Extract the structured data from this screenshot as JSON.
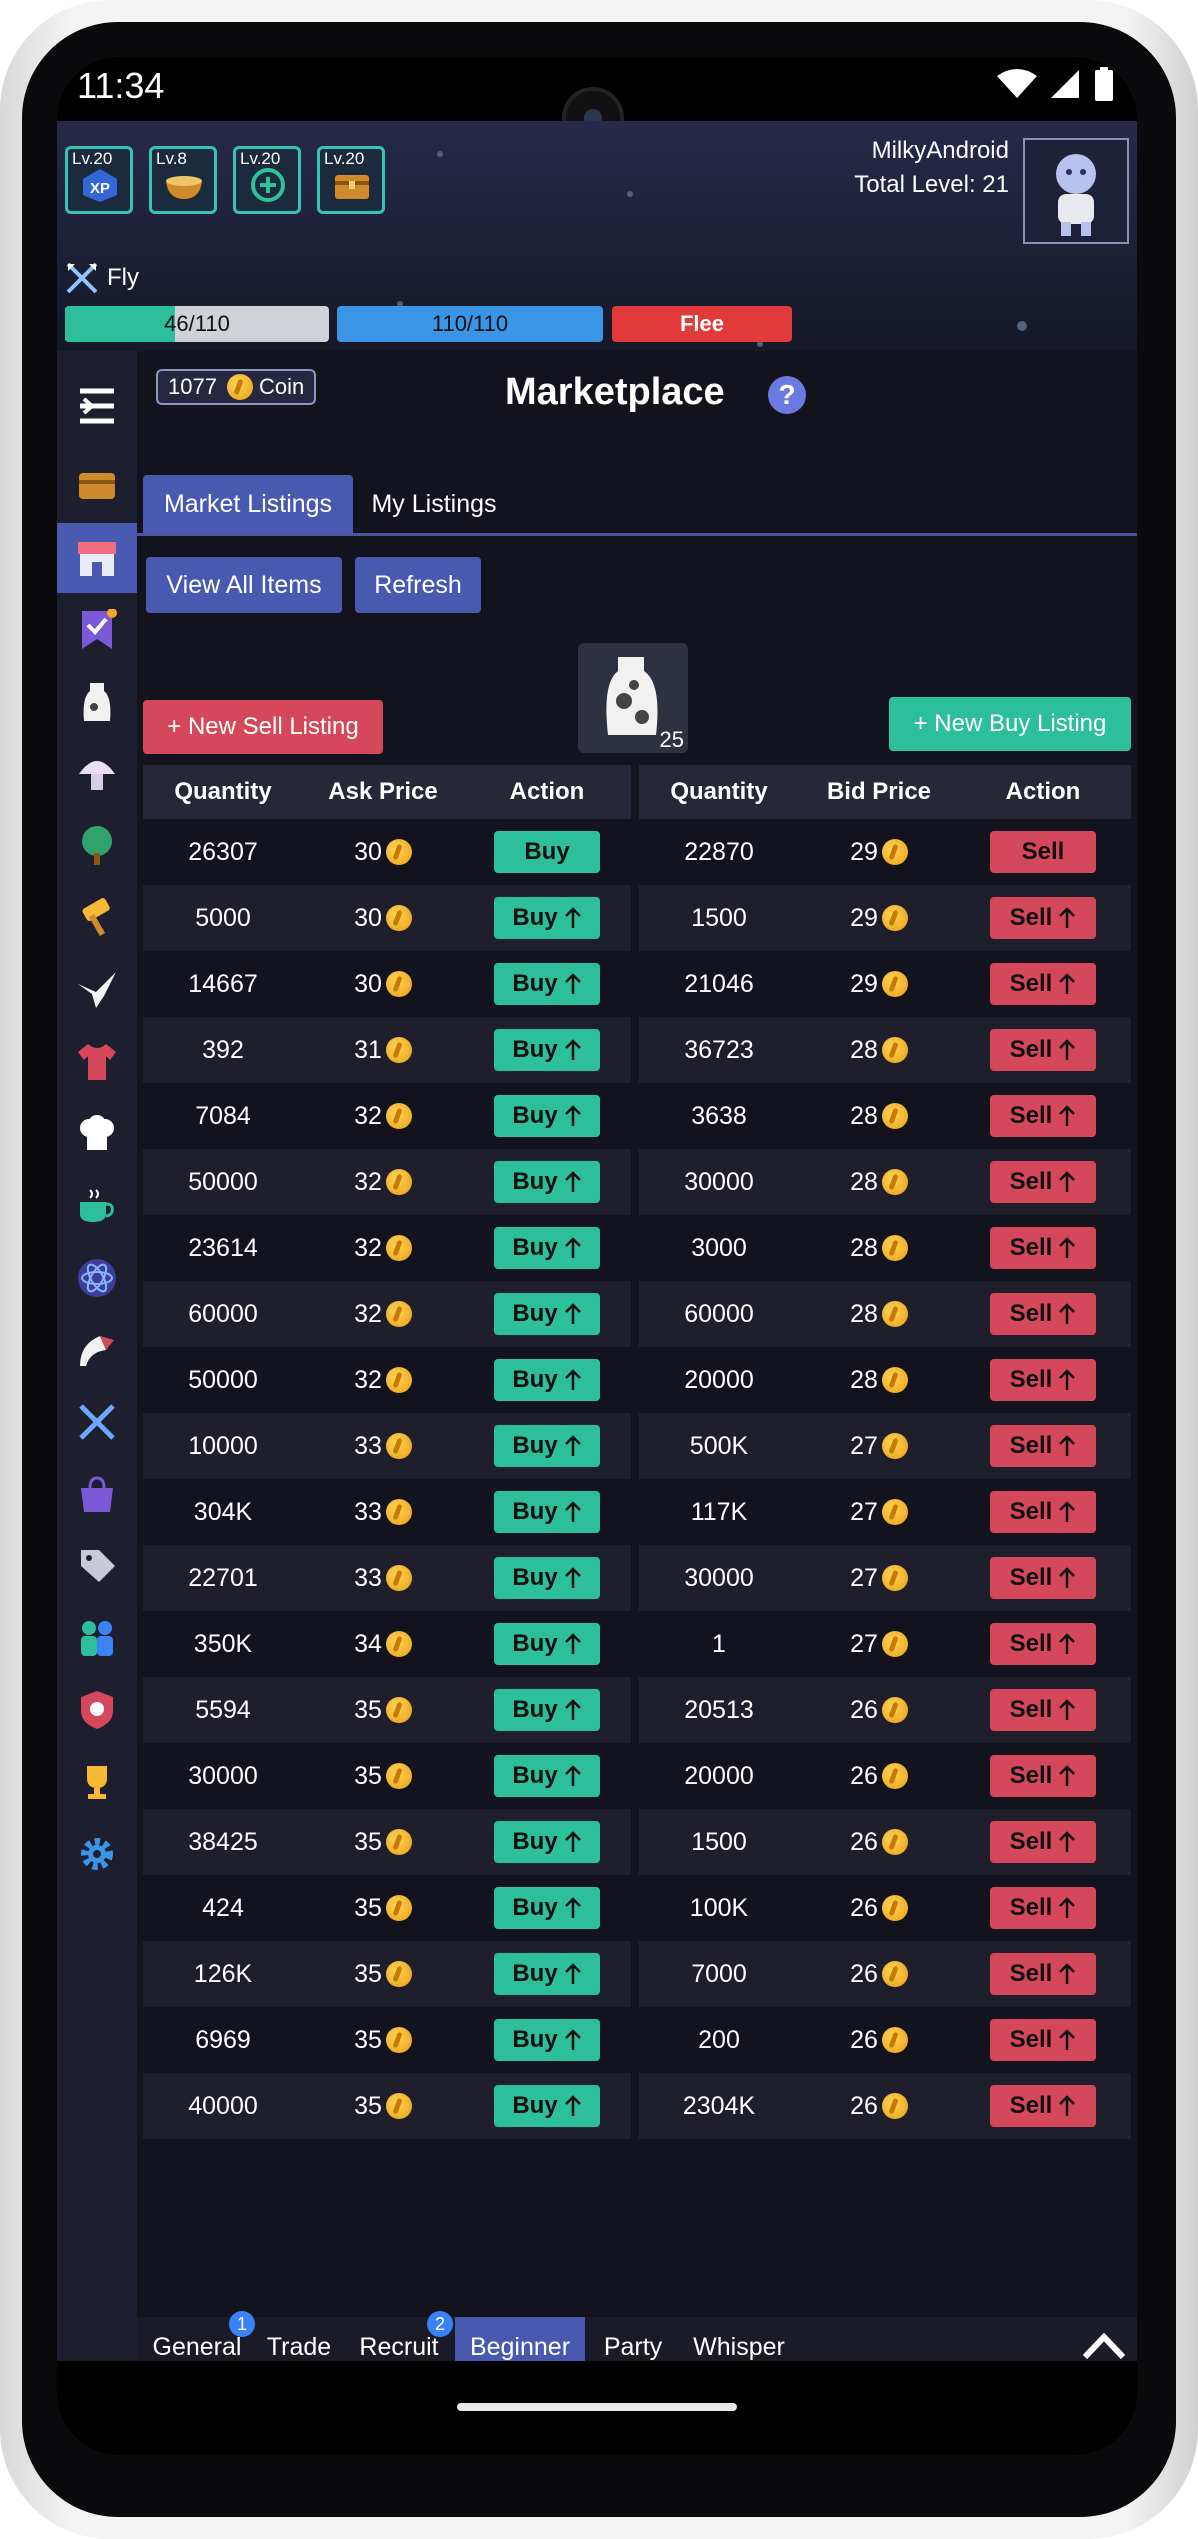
{
  "status_bar": {
    "time": "11:34"
  },
  "player": {
    "username": "MilkyAndroid",
    "total_level": "Total Level: 21",
    "skills": [
      {
        "level": "Lv.20",
        "icon": "xp-icon",
        "badge": "XP"
      },
      {
        "level": "Lv.8",
        "icon": "bowl-icon"
      },
      {
        "level": "Lv.20",
        "icon": "circle-plus-icon"
      },
      {
        "level": "Lv.20",
        "icon": "treasure-chest-icon"
      }
    ],
    "action": "Fly",
    "hp": "46/110",
    "hp_fraction": 0.418,
    "mp": "110/110",
    "mp_fraction": 1.0,
    "flee_label": "Flee"
  },
  "sidebar": {
    "items": [
      "menu-icon",
      "inventory-chest-icon",
      "marketplace-icon",
      "tasks-icon",
      "milk-icon",
      "mushroom-icon",
      "tree-icon",
      "hammer-icon",
      "origami-crane-icon",
      "shirt-icon",
      "chef-hat-icon",
      "tea-cup-icon",
      "atom-icon",
      "megaphone-icon",
      "swords-icon",
      "shop-bag-icon",
      "tags-icon",
      "players-icon",
      "guild-badge-icon",
      "trophy-icon",
      "settings-icon"
    ]
  },
  "market": {
    "coin_count": "1077",
    "coin_label": "Coin",
    "title": "Marketplace",
    "help": "?",
    "tabs": [
      "Market Listings",
      "My Listings"
    ],
    "view_all_label": "View All Items",
    "refresh_label": "Refresh",
    "new_sell_label": "+ New Sell Listing",
    "new_buy_label": "+ New Buy Listing",
    "item_count": "25",
    "ask_headers": [
      "Quantity",
      "Ask Price",
      "Action"
    ],
    "bid_headers": [
      "Quantity",
      "Bid Price",
      "Action"
    ],
    "ask_rows": [
      {
        "qty": "26307",
        "price": "30",
        "action": "Buy",
        "arrow": false
      },
      {
        "qty": "5000",
        "price": "30",
        "action": "Buy",
        "arrow": true
      },
      {
        "qty": "14667",
        "price": "30",
        "action": "Buy",
        "arrow": true
      },
      {
        "qty": "392",
        "price": "31",
        "action": "Buy",
        "arrow": true
      },
      {
        "qty": "7084",
        "price": "32",
        "action": "Buy",
        "arrow": true
      },
      {
        "qty": "50000",
        "price": "32",
        "action": "Buy",
        "arrow": true
      },
      {
        "qty": "23614",
        "price": "32",
        "action": "Buy",
        "arrow": true
      },
      {
        "qty": "60000",
        "price": "32",
        "action": "Buy",
        "arrow": true
      },
      {
        "qty": "50000",
        "price": "32",
        "action": "Buy",
        "arrow": true
      },
      {
        "qty": "10000",
        "price": "33",
        "action": "Buy",
        "arrow": true
      },
      {
        "qty": "304K",
        "price": "33",
        "action": "Buy",
        "arrow": true
      },
      {
        "qty": "22701",
        "price": "33",
        "action": "Buy",
        "arrow": true
      },
      {
        "qty": "350K",
        "price": "34",
        "action": "Buy",
        "arrow": true
      },
      {
        "qty": "5594",
        "price": "35",
        "action": "Buy",
        "arrow": true
      },
      {
        "qty": "30000",
        "price": "35",
        "action": "Buy",
        "arrow": true
      },
      {
        "qty": "38425",
        "price": "35",
        "action": "Buy",
        "arrow": true
      },
      {
        "qty": "424",
        "price": "35",
        "action": "Buy",
        "arrow": true
      },
      {
        "qty": "126K",
        "price": "35",
        "action": "Buy",
        "arrow": true
      },
      {
        "qty": "6969",
        "price": "35",
        "action": "Buy",
        "arrow": true
      },
      {
        "qty": "40000",
        "price": "35",
        "action": "Buy",
        "arrow": true
      }
    ],
    "bid_rows": [
      {
        "qty": "22870",
        "price": "29",
        "action": "Sell",
        "arrow": false
      },
      {
        "qty": "1500",
        "price": "29",
        "action": "Sell",
        "arrow": true
      },
      {
        "qty": "21046",
        "price": "29",
        "action": "Sell",
        "arrow": true
      },
      {
        "qty": "36723",
        "price": "28",
        "action": "Sell",
        "arrow": true
      },
      {
        "qty": "3638",
        "price": "28",
        "action": "Sell",
        "arrow": true
      },
      {
        "qty": "30000",
        "price": "28",
        "action": "Sell",
        "arrow": true
      },
      {
        "qty": "3000",
        "price": "28",
        "action": "Sell",
        "arrow": true
      },
      {
        "qty": "60000",
        "price": "28",
        "action": "Sell",
        "arrow": true
      },
      {
        "qty": "20000",
        "price": "28",
        "action": "Sell",
        "arrow": true
      },
      {
        "qty": "500K",
        "price": "27",
        "action": "Sell",
        "arrow": true
      },
      {
        "qty": "117K",
        "price": "27",
        "action": "Sell",
        "arrow": true
      },
      {
        "qty": "30000",
        "price": "27",
        "action": "Sell",
        "arrow": true
      },
      {
        "qty": "1",
        "price": "27",
        "action": "Sell",
        "arrow": true
      },
      {
        "qty": "20513",
        "price": "26",
        "action": "Sell",
        "arrow": true
      },
      {
        "qty": "20000",
        "price": "26",
        "action": "Sell",
        "arrow": true
      },
      {
        "qty": "1500",
        "price": "26",
        "action": "Sell",
        "arrow": true
      },
      {
        "qty": "100K",
        "price": "26",
        "action": "Sell",
        "arrow": true
      },
      {
        "qty": "7000",
        "price": "26",
        "action": "Sell",
        "arrow": true
      },
      {
        "qty": "200",
        "price": "26",
        "action": "Sell",
        "arrow": true
      },
      {
        "qty": "2304K",
        "price": "26",
        "action": "Sell",
        "arrow": true
      }
    ]
  },
  "chat": {
    "tabs": [
      {
        "label": "General",
        "badge": "1"
      },
      {
        "label": "Trade",
        "badge": ""
      },
      {
        "label": "Recruit",
        "badge": "2"
      },
      {
        "label": "Beginner",
        "badge": ""
      },
      {
        "label": "Party",
        "badge": ""
      },
      {
        "label": "Whisper",
        "badge": ""
      }
    ],
    "active_tab": "Beginner"
  },
  "colors": {
    "accent": "#4a59b0",
    "buy": "#2cbf9a",
    "sell": "#d5475a",
    "hp": "#2cbf9a",
    "mp": "#3b95e6",
    "flee": "#e03a3a"
  }
}
